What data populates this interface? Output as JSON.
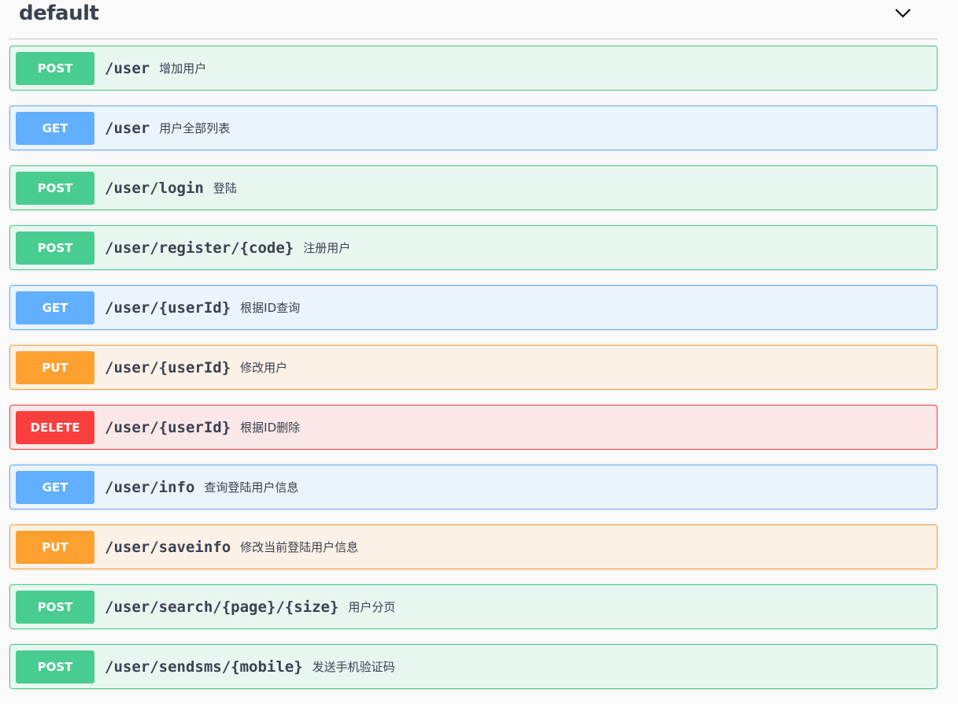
{
  "section": {
    "title": "default",
    "collapse_icon": "chevron-down-icon"
  },
  "operations": [
    {
      "method": "POST",
      "path": "/user",
      "summary": "增加用户"
    },
    {
      "method": "GET",
      "path": "/user",
      "summary": "用户全部列表"
    },
    {
      "method": "POST",
      "path": "/user/login",
      "summary": "登陆"
    },
    {
      "method": "POST",
      "path": "/user/register/{code}",
      "summary": "注册用户"
    },
    {
      "method": "GET",
      "path": "/user/{userId}",
      "summary": "根据ID查询"
    },
    {
      "method": "PUT",
      "path": "/user/{userId}",
      "summary": "修改用户"
    },
    {
      "method": "DELETE",
      "path": "/user/{userId}",
      "summary": "根据ID删除"
    },
    {
      "method": "GET",
      "path": "/user/info",
      "summary": "查询登陆用户信息"
    },
    {
      "method": "PUT",
      "path": "/user/saveinfo",
      "summary": "修改当前登陆用户信息"
    },
    {
      "method": "POST",
      "path": "/user/search/{page}/{size}",
      "summary": "用户分页"
    },
    {
      "method": "POST",
      "path": "/user/sendsms/{mobile}",
      "summary": "发送手机验证码"
    }
  ],
  "colors": {
    "post": "#49cc90",
    "get": "#61affe",
    "put": "#fca130",
    "delete": "#f93e3e"
  }
}
